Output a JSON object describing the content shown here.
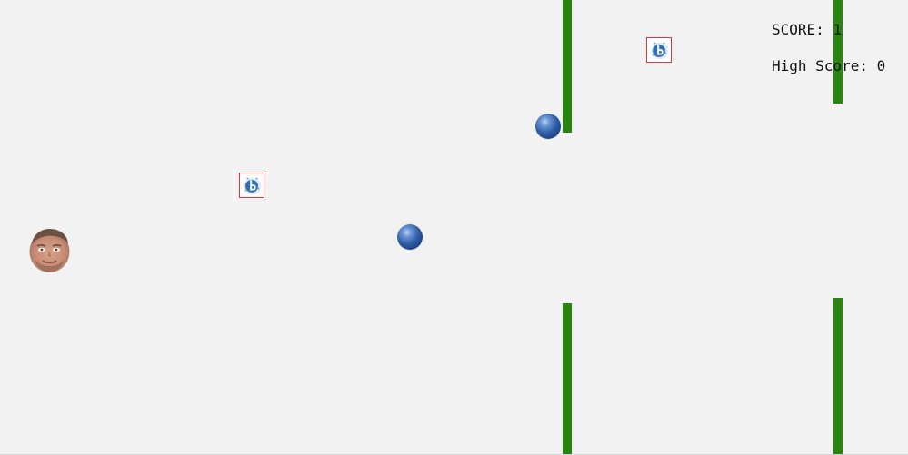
{
  "hud": {
    "score_label": "SCORE: 1",
    "high_score_label": "High Score: 0"
  },
  "colors": {
    "background": "#f2f2f2",
    "pipe": "#2a850f",
    "ball": "#2f5fa8",
    "logo_border": "#d63b3b"
  },
  "sprites": {
    "player": "player-face-icon",
    "obstacle_ball": "blue-sphere-icon",
    "collectible": "ib-logo-icon"
  }
}
